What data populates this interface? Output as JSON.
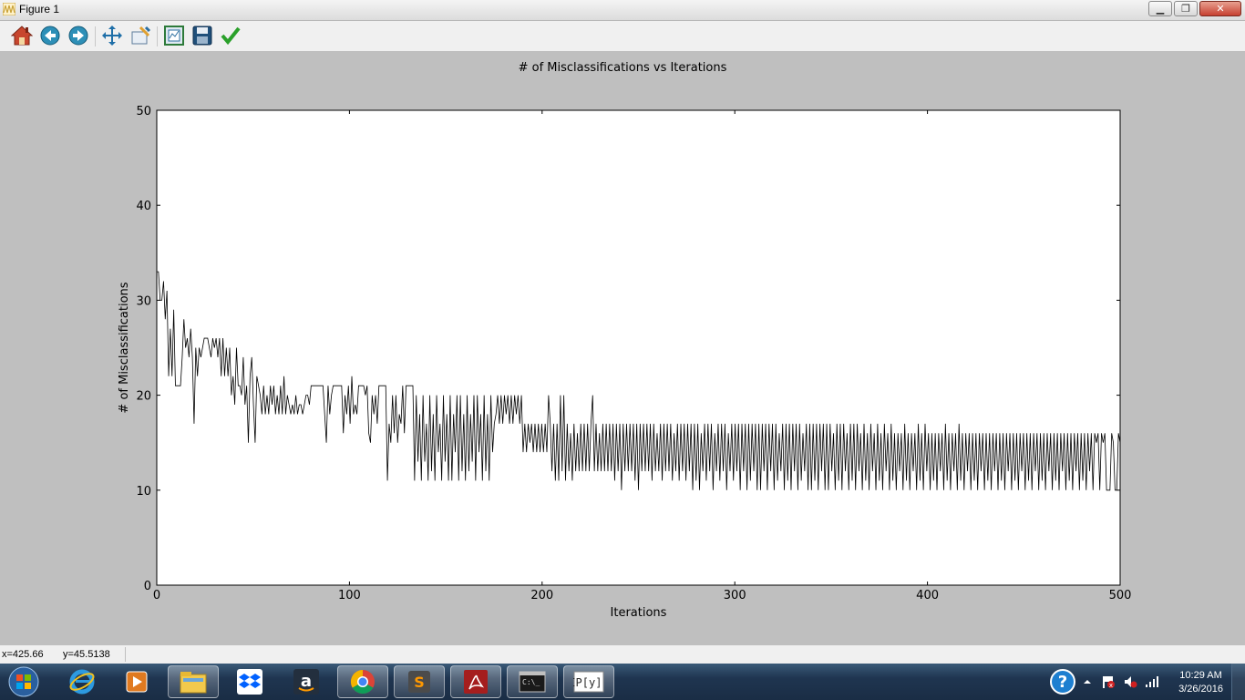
{
  "window": {
    "title": "Figure 1",
    "minimize_label": "▁",
    "restore_label": "❐",
    "close_label": "✕"
  },
  "toolbar": {
    "buttons": [
      {
        "icon": "home-icon",
        "tooltip": "Reset original view"
      },
      {
        "icon": "back-icon",
        "tooltip": "Back to previous view"
      },
      {
        "icon": "forward-icon",
        "tooltip": "Forward to next view"
      },
      {
        "icon": "pan-icon",
        "tooltip": "Pan axes"
      },
      {
        "icon": "zoom-icon",
        "tooltip": "Zoom to rectangle"
      },
      {
        "icon": "subplots-icon",
        "tooltip": "Configure subplots"
      },
      {
        "icon": "save-icon",
        "tooltip": "Save the figure"
      },
      {
        "icon": "edit-check-icon",
        "tooltip": "Edit curves line and axes parameters"
      }
    ]
  },
  "status": {
    "x_readout": "x=425.66",
    "y_readout": "y=45.5138"
  },
  "taskbar": {
    "apps": [
      "start-orb",
      "internet-explorer",
      "media-player",
      "file-explorer",
      "dropbox",
      "amazon",
      "chrome",
      "sublime-text",
      "acrobat",
      "command-prompt",
      "ipython"
    ],
    "help_label": "?",
    "time": "10:29 AM",
    "date": "3/26/2016"
  },
  "chart_data": {
    "type": "line",
    "title": "# of Misclassifications vs Iterations",
    "xlabel": "Iterations",
    "ylabel": "# of Misclassifications",
    "xlim": [
      0,
      500
    ],
    "ylim": [
      0,
      50
    ],
    "xticks": [
      0,
      100,
      200,
      300,
      400,
      500
    ],
    "yticks": [
      0,
      10,
      20,
      30,
      40,
      50
    ],
    "grid": false,
    "line_color": "#000000",
    "series": [
      {
        "values": [
          33,
          33,
          30,
          30,
          32,
          28,
          31,
          22,
          27,
          22,
          29,
          21,
          21,
          21,
          21,
          24,
          28,
          25,
          26,
          24,
          27,
          24,
          17,
          25,
          22,
          25,
          24,
          25,
          26,
          26,
          26,
          25,
          24,
          26,
          25,
          26,
          24,
          26,
          22,
          26,
          22,
          25,
          22,
          25,
          20,
          22,
          19,
          25,
          21,
          21,
          20,
          24,
          19,
          21,
          15,
          22,
          24,
          19,
          15,
          22,
          21,
          20,
          18,
          21,
          18,
          20,
          18,
          21,
          19,
          21,
          18,
          20,
          18,
          21,
          18,
          22,
          18,
          20,
          19,
          18,
          19,
          18,
          20,
          18,
          19,
          19,
          18,
          19,
          20,
          20,
          19,
          21,
          21,
          21,
          21,
          21,
          21,
          21,
          21,
          18,
          15,
          21,
          18,
          20,
          21,
          21,
          21,
          21,
          21,
          21,
          16,
          20,
          18,
          21,
          17,
          22,
          18,
          19,
          18,
          21,
          21,
          21,
          21,
          20,
          21,
          16,
          15,
          20,
          18,
          20,
          17,
          21,
          21,
          21,
          21,
          21,
          11,
          17,
          15,
          20,
          16,
          20,
          15,
          18,
          17,
          21,
          16,
          21,
          21,
          21,
          21,
          21,
          11,
          20,
          13,
          18,
          11,
          20,
          13,
          17,
          11,
          20,
          12,
          18,
          11,
          20,
          14,
          17,
          11,
          20,
          13,
          18,
          11,
          20,
          11,
          18,
          14,
          20,
          11,
          20,
          12,
          18,
          11,
          20,
          12,
          18,
          13,
          20,
          11,
          20,
          14,
          18,
          11,
          20,
          12,
          18,
          11,
          20,
          14,
          17,
          18,
          20,
          17,
          20,
          17,
          20,
          18,
          20,
          17,
          20,
          17,
          20,
          18,
          20,
          17,
          20,
          14,
          17,
          14,
          17,
          15,
          17,
          14,
          17,
          14,
          17,
          14,
          17,
          14,
          17,
          14,
          20,
          17,
          12,
          17,
          11,
          17,
          11,
          20,
          12,
          20,
          11,
          17,
          12,
          16,
          11,
          17,
          12,
          16,
          12,
          17,
          12,
          17,
          12,
          17,
          12,
          17,
          20,
          12,
          17,
          12,
          16,
          12,
          17,
          12,
          17,
          12,
          17,
          12,
          17,
          11,
          17,
          12,
          17,
          10,
          17,
          12,
          17,
          12,
          17,
          12,
          17,
          11,
          17,
          10,
          17,
          12,
          17,
          12,
          17,
          12,
          17,
          11,
          17,
          12,
          16,
          12,
          17,
          11,
          17,
          12,
          17,
          12,
          17,
          11,
          16,
          12,
          17,
          11,
          17,
          12,
          17,
          11,
          17,
          12,
          17,
          10,
          17,
          11,
          17,
          10,
          16,
          12,
          17,
          11,
          17,
          12,
          17,
          10,
          16,
          12,
          17,
          11,
          17,
          12,
          17,
          10,
          16,
          12,
          17,
          11,
          17,
          12,
          17,
          10,
          17,
          12,
          17,
          10,
          17,
          11,
          17,
          12,
          17,
          10,
          17,
          10,
          17,
          12,
          17,
          10,
          17,
          12,
          17,
          10,
          17,
          11,
          16,
          12,
          17,
          10,
          17,
          11,
          17,
          10,
          17,
          12,
          17,
          10,
          17,
          11,
          16,
          12,
          17,
          10,
          17,
          10,
          17,
          11,
          17,
          10,
          17,
          12,
          17,
          10,
          17,
          10,
          17,
          12,
          16,
          10,
          17,
          11,
          17,
          10,
          17,
          12,
          16,
          10,
          17,
          11,
          17,
          10,
          17,
          12,
          16,
          10,
          17,
          11,
          16,
          10,
          17,
          12,
          16,
          10,
          17,
          11,
          16,
          10,
          17,
          12,
          16,
          10,
          17,
          11,
          16,
          10,
          16,
          12,
          16,
          10,
          17,
          11,
          16,
          10,
          16,
          12,
          16,
          10,
          17,
          11,
          16,
          10,
          17,
          12,
          16,
          10,
          16,
          11,
          16,
          10,
          16,
          12,
          16,
          10,
          17,
          11,
          16,
          10,
          16,
          12,
          16,
          10,
          17,
          11,
          16,
          10,
          16,
          12,
          16,
          10,
          16,
          11,
          16,
          10,
          16,
          12,
          16,
          10,
          16,
          11,
          16,
          10,
          16,
          12,
          16,
          10,
          16,
          11,
          16,
          10,
          16,
          12,
          16,
          10,
          16,
          11,
          16,
          10,
          16,
          12,
          16,
          10,
          16,
          11,
          16,
          10,
          16,
          12,
          16,
          10,
          16,
          11,
          16,
          10,
          16,
          12,
          16,
          10,
          16,
          11,
          16,
          10,
          16,
          12,
          16,
          10,
          16,
          11,
          16,
          10,
          16,
          12,
          16,
          10,
          16,
          11,
          16,
          10,
          16,
          12,
          16,
          10,
          16,
          15,
          16,
          10,
          16,
          15,
          16,
          10,
          10,
          10,
          16,
          15,
          10,
          10,
          16,
          15
        ]
      }
    ]
  }
}
